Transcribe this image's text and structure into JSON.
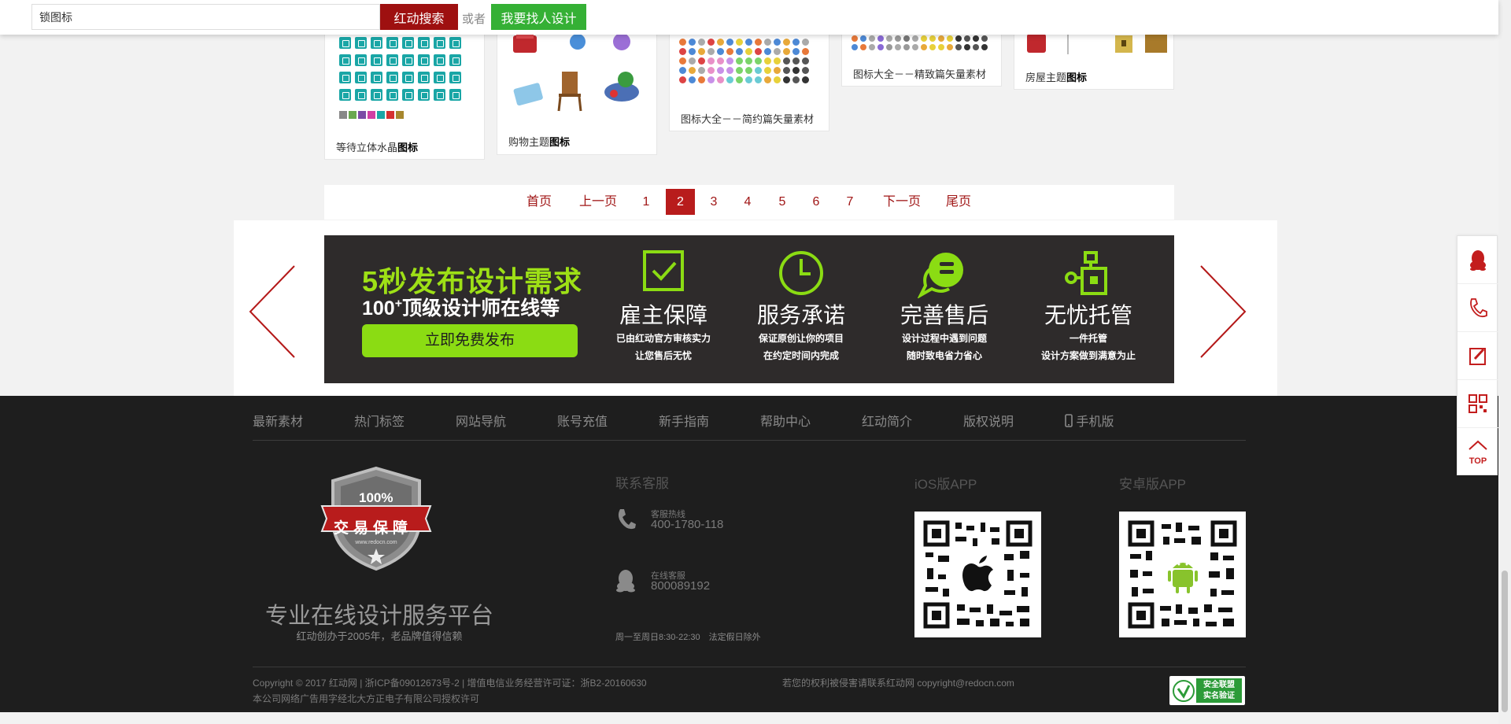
{
  "search": {
    "value": "锁图标",
    "button_label": "红动搜索",
    "or_text": "或者",
    "design_button_label": "我要找人设计"
  },
  "cards": [
    {
      "title_plain": "等待立体水晶",
      "title_bold": "图标"
    },
    {
      "title_plain": "购物主题",
      "title_bold": "图标"
    },
    {
      "title_plain": "图标大全－－简约篇矢量素材",
      "title_bold": ""
    },
    {
      "title_plain": "图标大全－－精致篇矢量素材",
      "title_bold": ""
    },
    {
      "title_plain": "房屋主题",
      "title_bold": "图标"
    }
  ],
  "pagination": {
    "first": "首页",
    "prev": "上一页",
    "pages": [
      "1",
      "2",
      "3",
      "4",
      "5",
      "6",
      "7"
    ],
    "active_page": "2",
    "next": "下一页",
    "last": "尾页"
  },
  "promo": {
    "headline": "5秒发布设计需求",
    "subline_prefix": "100",
    "subline_sup": "+",
    "subline_suffix": "顶级设计师在线等",
    "cta": "立即免费发布",
    "accent_color": "#8bdc13",
    "features": [
      {
        "icon": "checkbox-icon",
        "title": "雇主保障",
        "line1": "已由红动官方审核实力",
        "line2": "让您售后无忧"
      },
      {
        "icon": "clock-icon",
        "title": "服务承诺",
        "line1": "保证原创让你的项目",
        "line2": "在约定时间内完成"
      },
      {
        "icon": "chat-bubble-icon",
        "title": "完善售后",
        "line1": "设计过程中遇到问题",
        "line2": "随时致电省力省心"
      },
      {
        "icon": "network-icon",
        "title": "无忧托管",
        "line1": "一件托管",
        "line2": "设计方案做到满意为止"
      }
    ]
  },
  "footer": {
    "nav": [
      "最新素材",
      "热门标签",
      "网站导航",
      "账号充值",
      "新手指南",
      "帮助中心",
      "红动简介",
      "版权说明",
      "手机版"
    ],
    "shield": {
      "percent": "100%",
      "banner": "交易保障",
      "url": "www.redocn.com"
    },
    "slogan": "专业在线设计服务平台",
    "slogan_sub": "红动创办于2005年，老品牌值得信赖",
    "contact_heading": "联系客服",
    "hotline_label": "客服热线",
    "hotline_value": "400-1780-118",
    "online_label": "在线客服",
    "online_value": "800089192",
    "hours": "周一至周日8:30-22:30　法定假日除外",
    "ios_heading": "iOS版APP",
    "android_heading": "安卓版APP",
    "copyright_line1": "Copyright © 2017 红动网 | 浙ICP备09012673号-2 | 增值电信业务经营许可证：浙B2-20160630",
    "copyright_line2": "本公司网络广告用字经北大方正电子有限公司授权许可",
    "copyright_right": "若您的权利被侵害请联系红动网 copyright@redocn.com",
    "trust_badge_line1": "安全联盟",
    "trust_badge_line2": "实名验证"
  },
  "sidebar": {
    "items": [
      "qq-icon",
      "phone-icon",
      "edit-icon",
      "qrcode-icon",
      "top-arrow-icon"
    ],
    "top_label": "TOP"
  },
  "colors": {
    "brand_red": "#9e1010",
    "green_button": "#35b035",
    "footer_bg": "#1e1e1e"
  }
}
